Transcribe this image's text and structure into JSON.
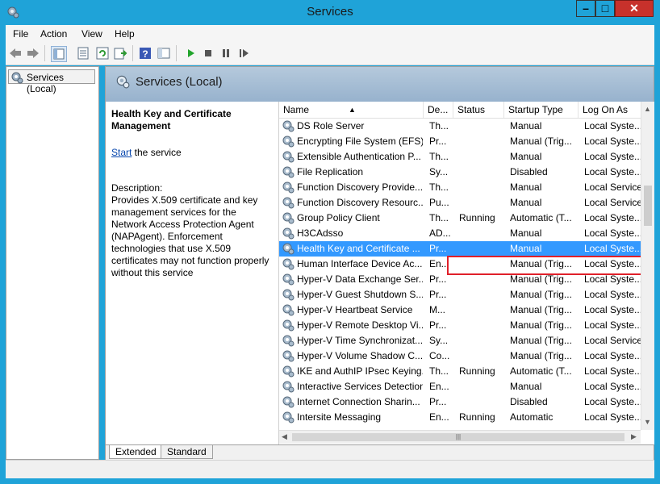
{
  "window": {
    "title": "Services"
  },
  "menu": [
    "File",
    "Action",
    "View",
    "Help"
  ],
  "toolbar_icons": [
    "back-icon",
    "forward-icon",
    "show-hide-console-tree-icon",
    "properties-icon",
    "refresh-icon",
    "export-list-icon",
    "help-icon",
    "console-help-icon",
    "start-service-icon",
    "stop-service-icon",
    "pause-service-icon",
    "restart-service-icon"
  ],
  "tree": {
    "root_label": "Services (Local)"
  },
  "header": {
    "title": "Services (Local)"
  },
  "details": {
    "service_name": "Health Key and Certificate Management",
    "start_link": "Start",
    "start_rest": " the service",
    "description_label": "Description:",
    "description": "Provides X.509 certificate and key management services for the Network Access Protection Agent (NAPAgent). Enforcement technologies that use X.509 certificates may not function properly without this service"
  },
  "columns": [
    "Name",
    "De...",
    "Status",
    "Startup Type",
    "Log On As"
  ],
  "rows": [
    {
      "name": "DS Role Server",
      "desc": "Th...",
      "status": "",
      "startup": "Manual",
      "logon": "Local Syste..."
    },
    {
      "name": "Encrypting File System (EFS)",
      "desc": "Pr...",
      "status": "",
      "startup": "Manual (Trig...",
      "logon": "Local Syste..."
    },
    {
      "name": "Extensible Authentication P...",
      "desc": "Th...",
      "status": "",
      "startup": "Manual",
      "logon": "Local Syste..."
    },
    {
      "name": "File Replication",
      "desc": "Sy...",
      "status": "",
      "startup": "Disabled",
      "logon": "Local Syste..."
    },
    {
      "name": "Function Discovery Provide...",
      "desc": "Th...",
      "status": "",
      "startup": "Manual",
      "logon": "Local Service"
    },
    {
      "name": "Function Discovery Resourc...",
      "desc": "Pu...",
      "status": "",
      "startup": "Manual",
      "logon": "Local Service"
    },
    {
      "name": "Group Policy Client",
      "desc": "Th...",
      "status": "Running",
      "startup": "Automatic (T...",
      "logon": "Local Syste..."
    },
    {
      "name": "H3CAdsso",
      "desc": "AD...",
      "status": "",
      "startup": "Manual",
      "logon": "Local Syste..."
    },
    {
      "name": "Health Key and Certificate ...",
      "desc": "Pr...",
      "status": "",
      "startup": "Manual",
      "logon": "Local Syste..."
    },
    {
      "name": "Human Interface Device Ac...",
      "desc": "En...",
      "status": "",
      "startup": "Manual (Trig...",
      "logon": "Local Syste..."
    },
    {
      "name": "Hyper-V Data Exchange Ser...",
      "desc": "Pr...",
      "status": "",
      "startup": "Manual (Trig...",
      "logon": "Local Syste..."
    },
    {
      "name": "Hyper-V Guest Shutdown S...",
      "desc": "Pr...",
      "status": "",
      "startup": "Manual (Trig...",
      "logon": "Local Syste..."
    },
    {
      "name": "Hyper-V Heartbeat Service",
      "desc": "M...",
      "status": "",
      "startup": "Manual (Trig...",
      "logon": "Local Syste..."
    },
    {
      "name": "Hyper-V Remote Desktop Vi...",
      "desc": "Pr...",
      "status": "",
      "startup": "Manual (Trig...",
      "logon": "Local Syste..."
    },
    {
      "name": "Hyper-V Time Synchronizat...",
      "desc": "Sy...",
      "status": "",
      "startup": "Manual (Trig...",
      "logon": "Local Service"
    },
    {
      "name": "Hyper-V Volume Shadow C...",
      "desc": "Co...",
      "status": "",
      "startup": "Manual (Trig...",
      "logon": "Local Syste..."
    },
    {
      "name": "IKE and AuthIP IPsec Keying...",
      "desc": "Th...",
      "status": "Running",
      "startup": "Automatic (T...",
      "logon": "Local Syste..."
    },
    {
      "name": "Interactive Services Detection",
      "desc": "En...",
      "status": "",
      "startup": "Manual",
      "logon": "Local Syste..."
    },
    {
      "name": "Internet Connection Sharin...",
      "desc": "Pr...",
      "status": "",
      "startup": "Disabled",
      "logon": "Local Syste..."
    },
    {
      "name": "Intersite Messaging",
      "desc": "En...",
      "status": "Running",
      "startup": "Automatic",
      "logon": "Local Syste..."
    }
  ],
  "selected_row": 8,
  "highlighted_row": 7,
  "tabs": [
    "Extended",
    "Standard"
  ],
  "colors": {
    "selection": "#3399ff",
    "highlight_box": "#e0202a",
    "header_band": "#a9c0d7"
  }
}
